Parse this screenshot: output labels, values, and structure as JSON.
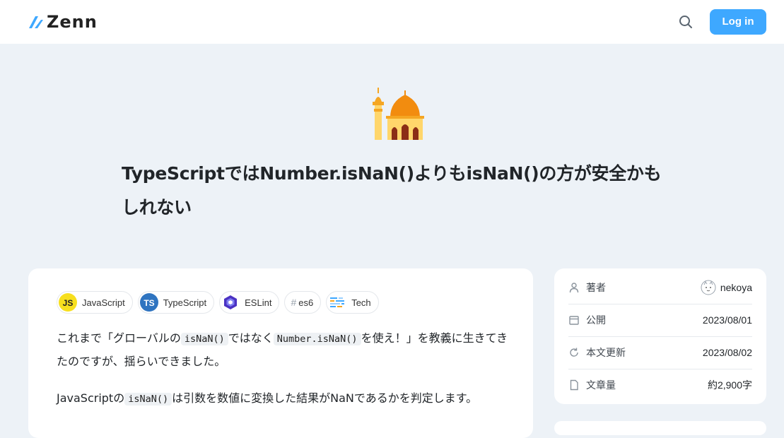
{
  "header": {
    "logo_text": "Zenn",
    "search_icon": "search-icon",
    "login_label": "Log in",
    "accent_color": "#3ea8ff"
  },
  "article": {
    "emoji": "mosque",
    "title_line1": "TypeScriptではNumber.isNaN()よりもisNaN()の方が安全かも",
    "title_line2": "しれない",
    "topics": [
      {
        "label": "JavaScript",
        "icon": "javascript-icon"
      },
      {
        "label": "TypeScript",
        "icon": "typescript-icon"
      },
      {
        "label": "ESLint",
        "icon": "eslint-icon"
      },
      {
        "label": "es6",
        "icon": "hash-icon"
      },
      {
        "label": "Tech",
        "icon": "tech-icon"
      }
    ],
    "p1_a": "これまで「グローバルの",
    "p1_code1": "isNaN()",
    "p1_b": "ではなく",
    "p1_code2": "Number.isNaN()",
    "p1_c": "を使え！」を教義に生きてきたのですが、揺らいできました。",
    "p2_a": "JavaScriptの",
    "p2_code": "isNaN()",
    "p2_b": "は引数を数値に変換した結果がNaNであるかを判定します。"
  },
  "info": {
    "rows": [
      {
        "label": "著者",
        "value": "nekoya",
        "icon": "user-icon"
      },
      {
        "label": "公開",
        "value": "2023/08/01",
        "icon": "calendar-icon"
      },
      {
        "label": "本文更新",
        "value": "2023/08/02",
        "icon": "refresh-icon"
      },
      {
        "label": "文章量",
        "value": "約2,900字",
        "icon": "document-icon"
      }
    ]
  }
}
